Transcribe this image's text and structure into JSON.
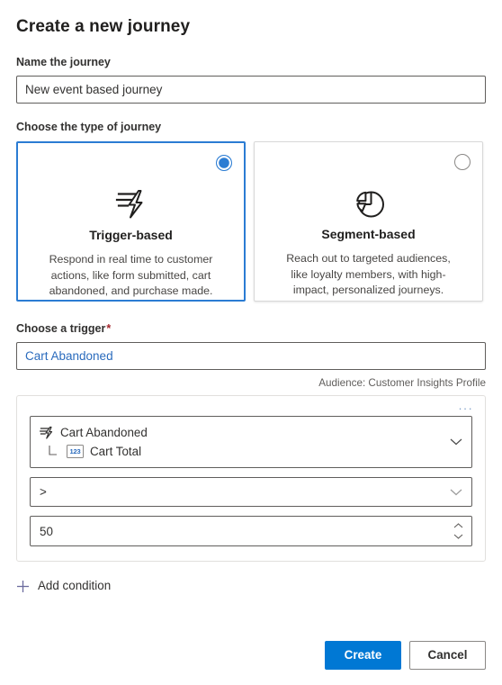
{
  "dialog": {
    "title": "Create a new journey"
  },
  "name_field": {
    "label": "Name the journey",
    "value": "New event based journey",
    "placeholder": "Name the journey"
  },
  "journey_type": {
    "label": "Choose the type of journey",
    "cards": [
      {
        "icon": "trigger-lightning-icon",
        "title": "Trigger-based",
        "description": "Respond in real time to customer actions, like form submitted, cart abandoned, and purchase made.",
        "selected": true
      },
      {
        "icon": "pie-chart-icon",
        "title": "Segment-based",
        "description": "Reach out to targeted audiences, like loyalty members, with high-impact, personalized journeys.",
        "selected": false
      }
    ]
  },
  "trigger": {
    "label": "Choose a trigger",
    "required_marker": "*",
    "value": "Cart Abandoned",
    "placeholder": "Choose a trigger",
    "audience_note": "Audience: Customer Insights Profile"
  },
  "condition": {
    "overflow_label": "···",
    "attribute": {
      "trigger_icon": "trigger-lightning-icon",
      "trigger_name": "Cart Abandoned",
      "field_type_icon": "number-type-icon",
      "field_type_label": "123",
      "field_name": "Cart Total"
    },
    "operator": ">",
    "value": "50",
    "add_condition_label": "Add condition"
  },
  "footer": {
    "create_label": "Create",
    "cancel_label": "Cancel"
  },
  "colors": {
    "accent": "#0078d4",
    "selected_card_border": "#2b7cd3",
    "link_text": "#2a6bbd",
    "required_star": "#a4262c",
    "plus_icon": "#6b6b9e"
  }
}
